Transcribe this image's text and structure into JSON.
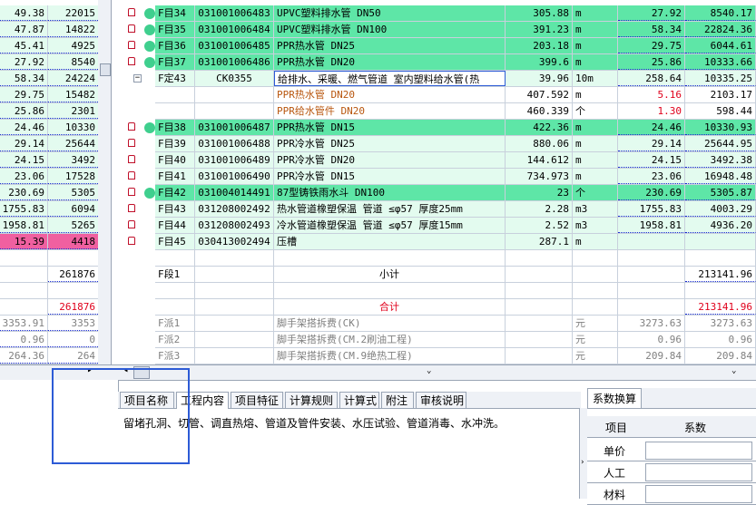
{
  "left_rows": [
    {
      "a": "49.38",
      "b": "22015",
      "style": "lightgreen"
    },
    {
      "a": "47.87",
      "b": "14822",
      "style": "lightgreen"
    },
    {
      "a": "45.41",
      "b": "4925",
      "style": "lightgreen"
    },
    {
      "a": "27.92",
      "b": "8540",
      "style": "lightgreen"
    },
    {
      "a": "58.34",
      "b": "24224",
      "style": "lightgreen"
    },
    {
      "a": "29.75",
      "b": "15482",
      "style": "lightgreen"
    },
    {
      "a": "25.86",
      "b": "2301",
      "style": "lightgreen"
    },
    {
      "a": "24.46",
      "b": "10330",
      "style": "lightgreen"
    },
    {
      "a": "29.14",
      "b": "25644",
      "style": "lightgreen"
    },
    {
      "a": "24.15",
      "b": "3492",
      "style": "lightgreen"
    },
    {
      "a": "23.06",
      "b": "17528",
      "style": "lightgreen"
    },
    {
      "a": "230.69",
      "b": "5305",
      "style": "lightgreen"
    },
    {
      "a": "1755.83",
      "b": "6094",
      "style": "lightgreen"
    },
    {
      "a": "1958.81",
      "b": "5265",
      "style": "lightgreen"
    },
    {
      "a": "15.39",
      "b": "4418",
      "style": "pink"
    },
    {
      "a": "",
      "b": "",
      "style": "white"
    },
    {
      "a": "",
      "b": "261876",
      "style": "white"
    },
    {
      "a": "",
      "b": "",
      "style": "white"
    },
    {
      "a": "",
      "b": "261876",
      "style": "redb"
    },
    {
      "a": "3353.91",
      "b": "3353",
      "style": "grey"
    },
    {
      "a": "0.96",
      "b": "0",
      "style": "grey"
    },
    {
      "a": "264.36",
      "b": "264",
      "style": "grey"
    }
  ],
  "grid_rows": [
    {
      "no": "F目34",
      "code": "031001006483",
      "name": "UPVC塑料排水管 DN50",
      "qty": "305.88",
      "unit": "m",
      "price": "27.92",
      "total": "8540.17",
      "style": "green",
      "mark": "33"
    },
    {
      "no": "F目35",
      "code": "031001006484",
      "name": "UPVC塑料排水管 DN100",
      "qty": "391.23",
      "unit": "m",
      "price": "58.34",
      "total": "22824.36",
      "style": "green",
      "mark": "34"
    },
    {
      "no": "F目36",
      "code": "031001006485",
      "name": "PPR热水管 DN25",
      "qty": "203.18",
      "unit": "m",
      "price": "29.75",
      "total": "6044.61",
      "style": "green",
      "mark": "35"
    },
    {
      "no": "F目37",
      "code": "031001006486",
      "name": "PPR热水管 DN20",
      "qty": "399.6",
      "unit": "m",
      "price": "25.86",
      "total": "10333.66",
      "style": "green",
      "mark": "36"
    },
    {
      "no": "F定43",
      "code": "CK0355",
      "name": "给排水、采暖、燃气管道 室内塑料给水管(热",
      "qty": "39.96",
      "unit": "10m",
      "price": "258.64",
      "total": "10335.25",
      "style": "lightgreen",
      "mark": ""
    },
    {
      "no": "",
      "code": "",
      "name": "PPR热水管 DN20",
      "qty": "407.592",
      "unit": "m",
      "price": "5.16",
      "total": "2103.17",
      "style": "white",
      "mark": "",
      "nameclass": "orange",
      "priceclass": "red"
    },
    {
      "no": "",
      "code": "",
      "name": "PPR给水管件 DN20",
      "qty": "460.339",
      "unit": "个",
      "price": "1.30",
      "total": "598.44",
      "style": "white",
      "mark": "",
      "nameclass": "orange",
      "priceclass": "red"
    },
    {
      "no": "F目38",
      "code": "031001006487",
      "name": "PPR热水管 DN15",
      "qty": "422.36",
      "unit": "m",
      "price": "24.46",
      "total": "10330.93",
      "style": "green",
      "mark": "37"
    },
    {
      "no": "F目39",
      "code": "031001006488",
      "name": "PPR冷水管 DN25",
      "qty": "880.06",
      "unit": "m",
      "price": "29.14",
      "total": "25644.95",
      "style": "lightgreen",
      "mark": ""
    },
    {
      "no": "F目40",
      "code": "031001006489",
      "name": "PPR冷水管 DN20",
      "qty": "144.612",
      "unit": "m",
      "price": "24.15",
      "total": "3492.38",
      "style": "lightgreen",
      "mark": ""
    },
    {
      "no": "F目41",
      "code": "031001006490",
      "name": "PPR冷水管 DN15",
      "qty": "734.973",
      "unit": "m",
      "price": "23.06",
      "total": "16948.48",
      "style": "lightgreen",
      "mark": ""
    },
    {
      "no": "F目42",
      "code": "031004014491",
      "name": "87型铸铁雨水斗 DN100",
      "qty": "23",
      "unit": "个",
      "price": "230.69",
      "total": "5305.87",
      "style": "green",
      "mark": "38"
    },
    {
      "no": "F目43",
      "code": "031208002492",
      "name": "热水管道橡塑保温 管道 ≤φ57 厚度25mm",
      "qty": "2.28",
      "unit": "m3",
      "price": "1755.83",
      "total": "4003.29",
      "style": "lightgreen",
      "mark": ""
    },
    {
      "no": "F目44",
      "code": "031208002493",
      "name": "冷水管道橡塑保温 管道 ≤φ57 厚度15mm",
      "qty": "2.52",
      "unit": "m3",
      "price": "1958.81",
      "total": "4936.20",
      "style": "lightgreen",
      "mark": ""
    },
    {
      "no": "F目45",
      "code": "030413002494",
      "name": "压槽",
      "qty": "287.1",
      "unit": "m",
      "price": "",
      "total": "",
      "style": "lightgreen",
      "mark": ""
    },
    {
      "no": "",
      "code": "",
      "name": "",
      "qty": "",
      "unit": "",
      "price": "",
      "total": "",
      "style": "white",
      "mark": ""
    },
    {
      "no": "F段1",
      "code": "",
      "name": "小计",
      "qty": "",
      "unit": "",
      "price": "",
      "total": "213141.96",
      "style": "white",
      "mark": "",
      "center": true
    },
    {
      "no": "",
      "code": "",
      "name": "",
      "qty": "",
      "unit": "",
      "price": "",
      "total": "",
      "style": "white",
      "mark": ""
    },
    {
      "no": "",
      "code": "",
      "name": "合计",
      "qty": "",
      "unit": "",
      "price": "",
      "total": "213141.96",
      "style": "white",
      "mark": "",
      "center": true,
      "red": true
    },
    {
      "no": "F派1",
      "code": "",
      "name": "脚手架搭拆费(CK)",
      "qty": "",
      "unit": "元",
      "price": "3273.63",
      "total": "3273.63",
      "style": "white",
      "mark": "",
      "grey": true
    },
    {
      "no": "F派2",
      "code": "",
      "name": "脚手架搭拆费(CM.2刷油工程)",
      "qty": "",
      "unit": "元",
      "price": "0.96",
      "total": "0.96",
      "style": "white",
      "mark": "",
      "grey": true
    },
    {
      "no": "F派3",
      "code": "",
      "name": "脚手架搭拆费(CM.9绝热工程)",
      "qty": "",
      "unit": "元",
      "price": "209.84",
      "total": "209.84",
      "style": "white",
      "mark": "",
      "grey": true
    }
  ],
  "tabs": [
    {
      "label": "项目名称",
      "active": false
    },
    {
      "label": "工程内容",
      "active": true
    },
    {
      "label": "项目特征",
      "active": false
    },
    {
      "label": "计算规则",
      "active": false
    },
    {
      "label": "计算式",
      "active": false
    },
    {
      "label": "附注",
      "active": false
    },
    {
      "label": "审核说明",
      "active": false
    }
  ],
  "work_content": "留堵孔洞、切管、调直热熔、管道及管件安装、水压试验、管道消毒、水冲洗。",
  "factor": {
    "tab_label": "系数换算",
    "col_item": "项目",
    "col_factor": "系数",
    "rows": [
      "单价",
      "人工",
      "材料"
    ]
  },
  "colors": {
    "green": "#5ee6a7",
    "lightgreen": "#e3fbef",
    "pink": "#f060a0",
    "red": "#e0001b",
    "selection": "#2d5bd6"
  }
}
